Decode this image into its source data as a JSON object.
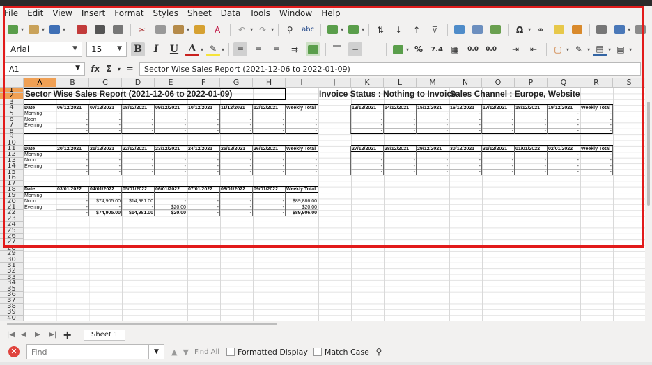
{
  "menu": [
    "File",
    "Edit",
    "View",
    "Insert",
    "Format",
    "Styles",
    "Sheet",
    "Data",
    "Tools",
    "Window",
    "Help"
  ],
  "font": {
    "name": "Arial",
    "size": "15"
  },
  "formula": {
    "cell_ref": "A1",
    "content": "Sector Wise Sales Report (2021-12-06 to 2022-01-09)",
    "fx": "fx",
    "sigma": "Σ",
    "equals": "="
  },
  "columns": [
    "A",
    "B",
    "C",
    "D",
    "E",
    "F",
    "G",
    "H",
    "I",
    "J",
    "K",
    "L",
    "M",
    "N",
    "O",
    "P",
    "Q",
    "R",
    "S"
  ],
  "rows": [
    "1",
    "2",
    "3",
    "4",
    "5",
    "6",
    "7",
    "8",
    "9",
    "10",
    "11",
    "12",
    "13",
    "14",
    "15",
    "16",
    "17",
    "18",
    "19",
    "20",
    "21",
    "22",
    "23",
    "24",
    "25",
    "26",
    "27",
    "28",
    "29",
    "30",
    "31",
    "32",
    "33",
    "34",
    "35",
    "36",
    "37",
    "38",
    "39",
    "40"
  ],
  "report": {
    "title": "Sector Wise Sales Report (2021-12-06 to 2022-01-09)",
    "invoice_status": "Invoice Status : Nothing to Invoice",
    "sales_channel": "Sales Channel : Europe, Website",
    "row_labels": [
      "Date",
      "Morning",
      "Noon",
      "Evening"
    ],
    "weekly_total": "Weekly Total",
    "dash": "-",
    "week1_dates": [
      "06/12/2021",
      "07/12/2021",
      "08/12/2021",
      "09/12/2021",
      "10/12/2021",
      "11/12/2021",
      "12/12/2021"
    ],
    "week2_dates": [
      "13/12/2021",
      "14/12/2021",
      "15/12/2021",
      "16/12/2021",
      "17/12/2021",
      "18/12/2021",
      "19/12/2021"
    ],
    "week3_dates": [
      "20/12/2021",
      "21/12/2021",
      "22/12/2021",
      "23/12/2021",
      "24/12/2021",
      "25/12/2021",
      "26/12/2021"
    ],
    "week4_dates": [
      "27/12/2021",
      "28/12/2021",
      "29/12/2021",
      "30/12/2021",
      "31/12/2021",
      "01/01/2022",
      "02/01/2022"
    ],
    "week5_dates": [
      "03/01/2022",
      "04/01/2022",
      "05/01/2022",
      "06/01/2022",
      "07/01/2022",
      "08/01/2022",
      "09/01/2022"
    ],
    "week5_values": {
      "noon_c": "$74,905.00",
      "noon_d": "$14,981.00",
      "noon_total": "$89,886.00",
      "evening_e": "$20.00",
      "evening_total": "$20.00",
      "total_c": "$74,905.00",
      "total_d": "$14,981.00",
      "total_e": "$20.00",
      "grand_total": "$89,906.00"
    }
  },
  "sheet_tab": "Sheet 1",
  "find": {
    "placeholder": "Find",
    "find_all": "Find All",
    "formatted_display": "Formatted Display",
    "match_case": "Match Case"
  }
}
